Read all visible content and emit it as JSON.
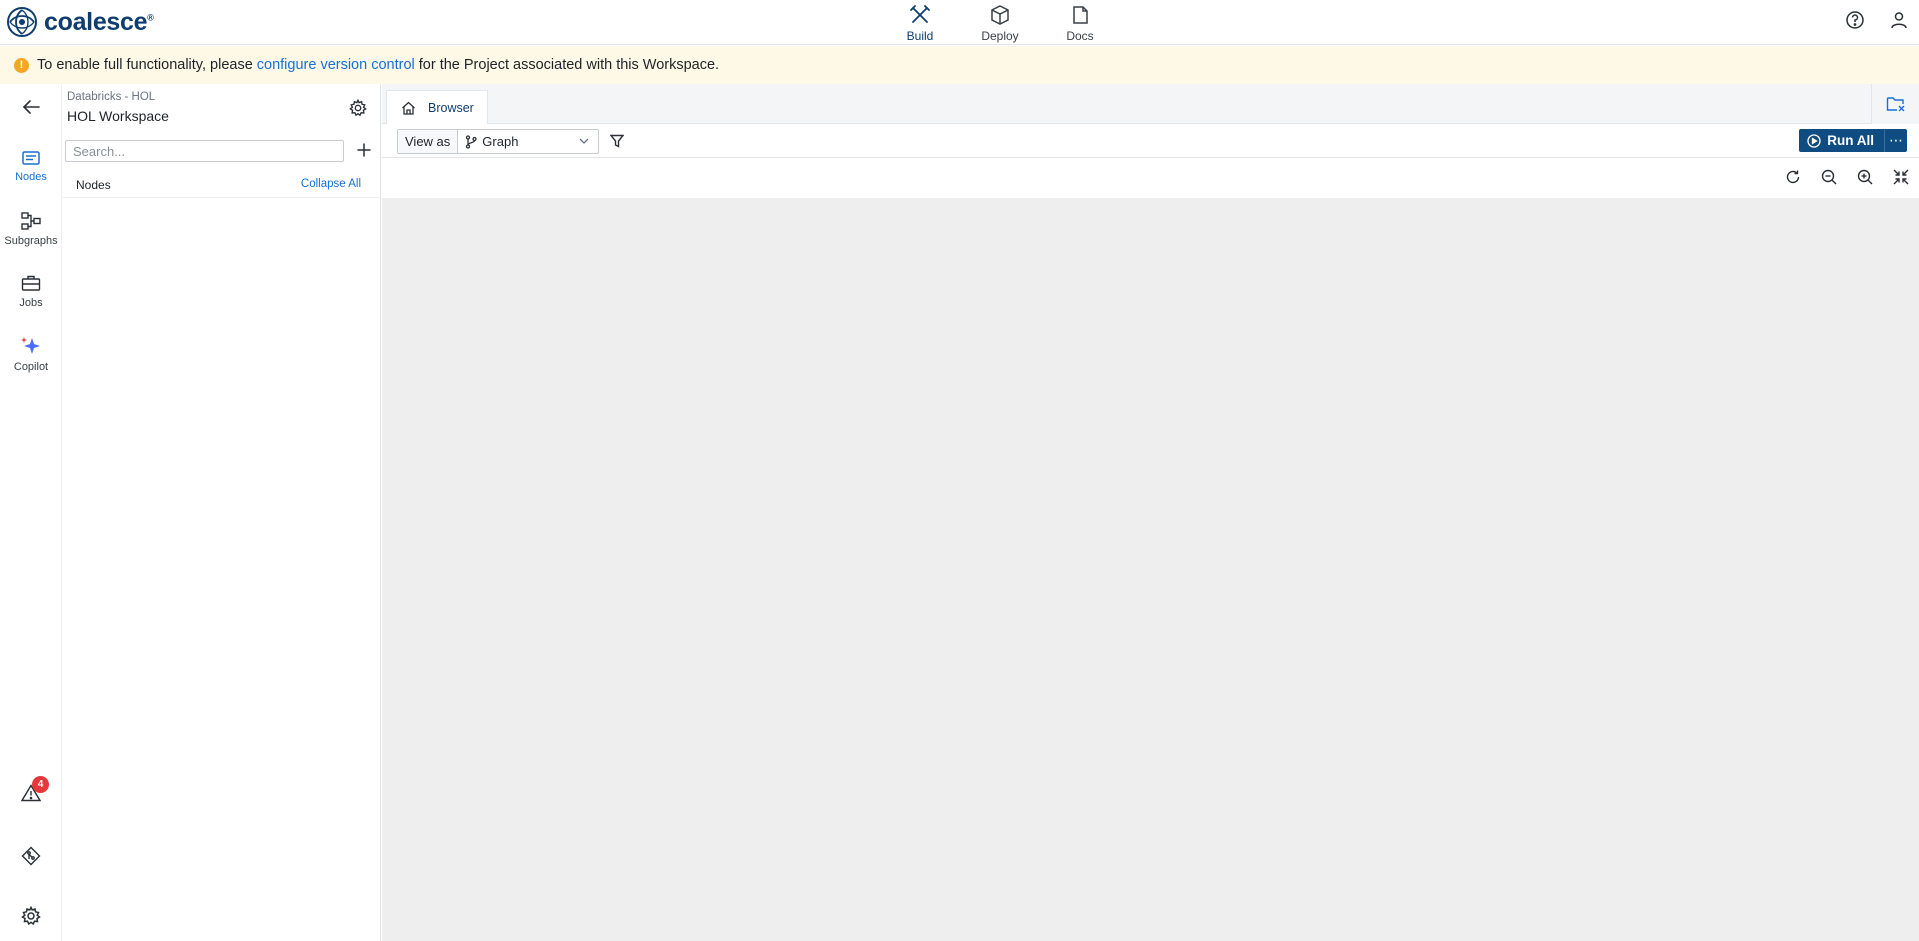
{
  "app": {
    "brand": "coalesce",
    "brand_mark": "®",
    "accent": "#0f3d6e",
    "link_color": "#1670d6"
  },
  "nav": [
    {
      "label": "Build",
      "icon": "build-tools-icon",
      "active": true
    },
    {
      "label": "Deploy",
      "icon": "deploy-box-icon",
      "active": false
    },
    {
      "label": "Docs",
      "icon": "docs-icon",
      "active": false
    }
  ],
  "banner": {
    "text_before": "To enable full functionality, please",
    "link": "configure version control",
    "text_after": "for the Project associated with this Workspace."
  },
  "rail": {
    "items": [
      {
        "label": "Nodes",
        "icon": "nodes-icon",
        "active": true
      },
      {
        "label": "Subgraphs",
        "icon": "subgraphs-icon",
        "active": false
      },
      {
        "label": "Jobs",
        "icon": "jobs-icon",
        "active": false
      },
      {
        "label": "Copilot",
        "icon": "copilot-sparkle-icon",
        "active": false
      }
    ],
    "alerts_count": "4"
  },
  "panel": {
    "project": "Databricks - HOL",
    "workspace": "HOL Workspace",
    "search_placeholder": "Search...",
    "section_title": "Nodes",
    "collapse_label": "Collapse All"
  },
  "tabs": [
    {
      "label": "Browser",
      "icon": "home-icon",
      "active": true
    }
  ],
  "toolbar": {
    "view_as_label": "View as",
    "view_as_value": "Graph",
    "run_all_label": "Run All",
    "more_label": "⋯"
  }
}
